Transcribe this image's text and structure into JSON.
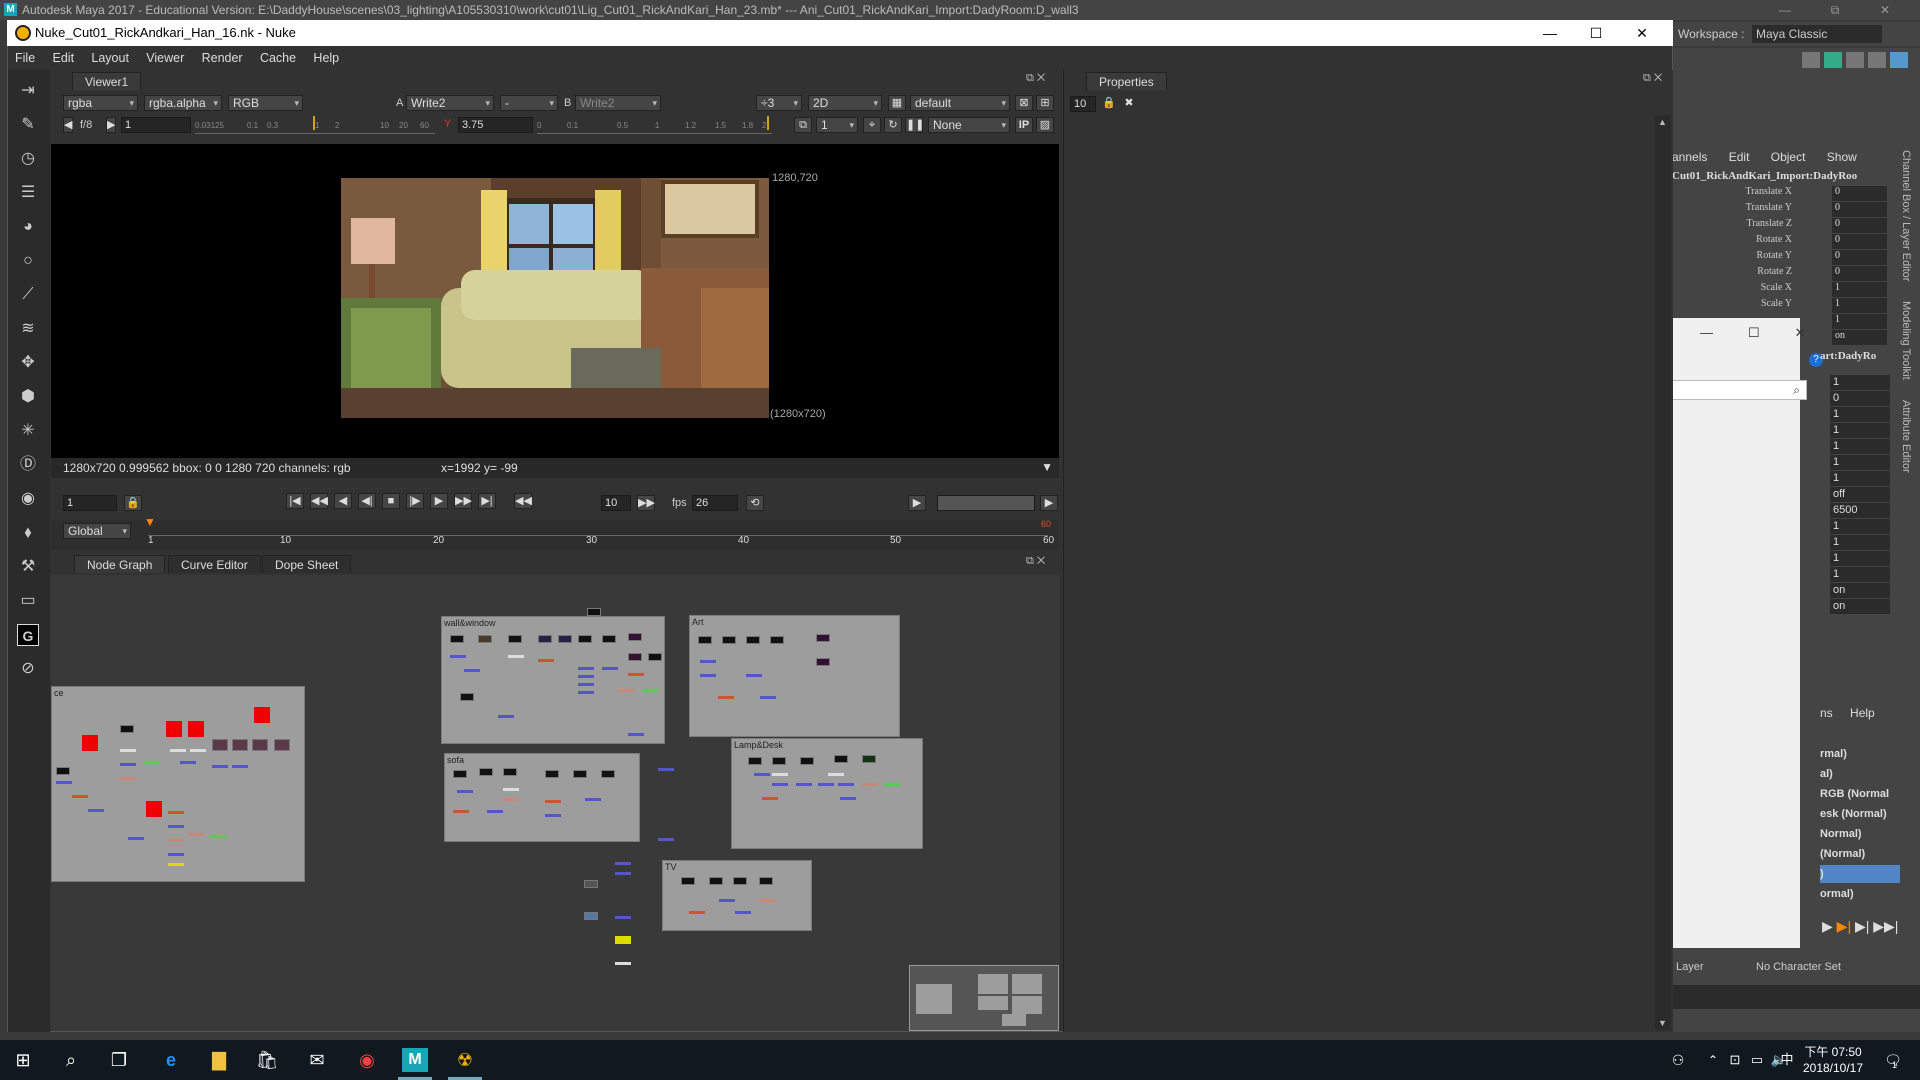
{
  "maya": {
    "title": "Autodesk Maya 2017 - Educational Version: E:\\DaddyHouse\\scenes\\03_lighting\\A105530310\\work\\cut01\\Lig_Cut01_RickAndKari_Han_23.mb*   ---   Ani_Cut01_RickAndKari_Import:DadyRoom:D_wall3",
    "workspace_label": "Workspace :",
    "workspace_value": "Maya Classic",
    "channel_menu": [
      "annels",
      "Edit",
      "Object",
      "Show"
    ],
    "channel_object": "Cut01_RickAndKari_Import:DadyRoo",
    "channels": [
      {
        "label": "Translate X",
        "value": "0"
      },
      {
        "label": "Translate Y",
        "value": "0"
      },
      {
        "label": "Translate Z",
        "value": "0"
      },
      {
        "label": "Rotate X",
        "value": "0"
      },
      {
        "label": "Rotate Y",
        "value": "0"
      },
      {
        "label": "Rotate Z",
        "value": "0"
      },
      {
        "label": "Scale X",
        "value": "1"
      },
      {
        "label": "Scale Y",
        "value": "1"
      },
      {
        "label": "",
        "value": "1"
      },
      {
        "label": "",
        "value": "on"
      }
    ],
    "shape_object": "art:DadyRo",
    "shape_values": [
      "1",
      "0",
      "1",
      "1",
      "1",
      "1",
      "1",
      "off",
      "6500",
      "1",
      "1",
      "1",
      "1",
      "on",
      "on"
    ],
    "vertical_tabs": [
      "Channel Box / Layer Editor",
      "Modeling Toolkit",
      "Attribute Editor"
    ],
    "layer_menu": [
      "ns",
      "Help"
    ],
    "layers": [
      "rmal)",
      "al)",
      " RGB (Normal",
      "esk (Normal)",
      "Normal)",
      "(Normal)",
      ")",
      "ormal)"
    ],
    "bottom_layer": "Layer",
    "character_set": "No Character Set"
  },
  "nuke": {
    "title": "Nuke_Cut01_RickAndkari_Han_16.nk - Nuke",
    "win_controls": [
      "—",
      "☐",
      "✕"
    ],
    "menu": [
      "File",
      "Edit",
      "Layout",
      "Viewer",
      "Render",
      "Cache",
      "Help"
    ],
    "viewer": {
      "tab": "Viewer1",
      "channels": "rgba",
      "alpha": "rgba.alpha",
      "display": "RGB",
      "input_a_label": "A",
      "input_a": "Write2",
      "op": "-",
      "input_b_label": "B",
      "input_b": "Write2",
      "downrez": "÷3",
      "mode": "2D",
      "lut": "default",
      "fstop": "f/8",
      "gain": "1",
      "gamma_label": "Y",
      "gamma": "3.75",
      "scale_ticks_left": [
        "0.03125",
        "0.1",
        "0.3",
        "1",
        "2",
        "10",
        "20",
        "60"
      ],
      "scale_ticks_right": [
        "0",
        "0.1",
        "0.5",
        "1",
        "1.2",
        "1.5",
        "1.8",
        "2"
      ],
      "proxy": "1",
      "roi": "None",
      "ip_label": "IP",
      "format_tr": "1280,720",
      "format_br": "(1280x720)",
      "info": "1280x720 0.999562 bbox: 0 0 1280 720 channels: rgb",
      "coords": "x=1992 y= -99"
    },
    "timeline": {
      "frame": "1",
      "step": "10",
      "fps_label": "fps",
      "fps": "26",
      "range_mode": "Global",
      "ticks": [
        "1",
        "10",
        "20",
        "30",
        "40",
        "50",
        "60"
      ],
      "end_marker": "60"
    },
    "properties": {
      "tab": "Properties",
      "max_panels": "10"
    },
    "nodegraph": {
      "tabs": [
        "Node Graph",
        "Curve Editor",
        "Dope Sheet"
      ],
      "backdrops": [
        "wall&window",
        "Art",
        "sofa",
        "Lamp&Desk",
        "TV",
        "ce"
      ]
    }
  },
  "taskbar": {
    "time": "下午 07:50",
    "date": "2018/10/17",
    "ime": "中",
    "notification_count": "1"
  },
  "colors": {
    "nuke_bg": "#323232",
    "backdrop": "#9d9d9d",
    "node_red": "#ee0000",
    "link_blue": "#4455cc",
    "link_red": "#cc3344",
    "taskbar": "#101820"
  }
}
